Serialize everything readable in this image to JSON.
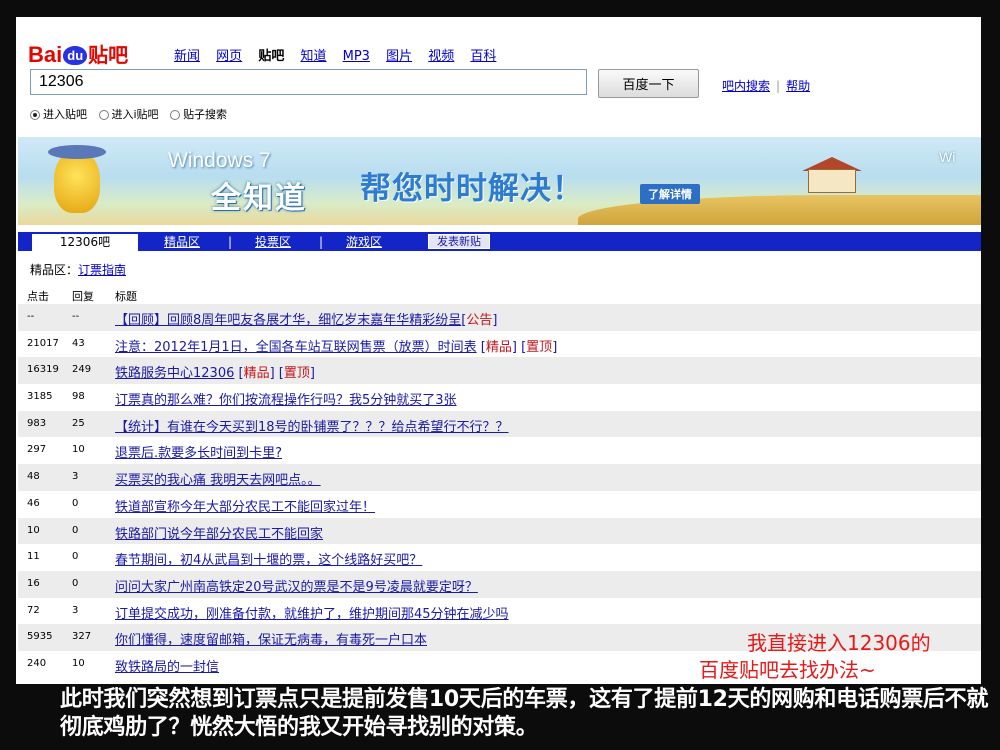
{
  "logo": {
    "part1": "Bai",
    "part2": "du",
    "part3": "贴吧"
  },
  "topnav": [
    "新闻",
    "网页",
    "贴吧",
    "知道",
    "MP3",
    "图片",
    "视频",
    "百科"
  ],
  "search": {
    "value": "12306",
    "button": "百度一下"
  },
  "right_links": [
    "吧内搜索",
    "帮助"
  ],
  "radios": [
    {
      "label": "进入贴吧",
      "checked": true
    },
    {
      "label": "进入i贴吧",
      "checked": false
    },
    {
      "label": "贴子搜索",
      "checked": false
    }
  ],
  "banner": {
    "brand": "Windows 7",
    "product": "全知道",
    "slogan": "帮您时时解决！",
    "more": "了解详情",
    "corner": "Wi"
  },
  "tabs": {
    "active": "12306吧",
    "items": [
      "精品区",
      "投票区",
      "游戏区"
    ],
    "post": "发表新贴"
  },
  "breadcrumb": {
    "section": "精品区：",
    "link": "订票指南"
  },
  "table": {
    "headers": [
      "点击",
      "回复",
      "标题"
    ],
    "rows": [
      {
        "clicks": "--",
        "replies": "--",
        "title": "【回顾】回顾8周年吧友各展才华，细忆岁末嘉年华精彩纷呈",
        "tags": [
          "公告"
        ]
      },
      {
        "clicks": "21017",
        "replies": "43",
        "title": "注意：2012年1月1日，全国各车站互联网售票（放票）时间表",
        "tags": [
          "精品",
          "置顶"
        ]
      },
      {
        "clicks": "16319",
        "replies": "249",
        "title": "铁路服务中心12306",
        "tags": [
          "精品",
          "置顶"
        ]
      },
      {
        "clicks": "3185",
        "replies": "98",
        "title": "订票真的那么难？你们按流程操作行吗？我5分钟就买了3张",
        "tags": []
      },
      {
        "clicks": "983",
        "replies": "25",
        "title": "【统计】有谁在今天买到18号的卧铺票了？？？给点希望行不行？？",
        "tags": []
      },
      {
        "clicks": "297",
        "replies": "10",
        "title": "退票后.款要多长时间到卡里?",
        "tags": []
      },
      {
        "clicks": "48",
        "replies": "3",
        "title": "买票买的我心痛 我明天去网吧点。。",
        "tags": []
      },
      {
        "clicks": "46",
        "replies": "0",
        "title": "铁道部宣称今年大部分农民工不能回家过年！",
        "tags": []
      },
      {
        "clicks": "10",
        "replies": "0",
        "title": "铁路部门说今年部分农民工不能回家",
        "tags": []
      },
      {
        "clicks": "11",
        "replies": "0",
        "title": "春节期间，初4从武昌到十堰的票，这个线路好买吧？",
        "tags": []
      },
      {
        "clicks": "16",
        "replies": "0",
        "title": "问问大家广州南高铁定20号武汉的票是不是9号凌晨就要定呀？",
        "tags": []
      },
      {
        "clicks": "72",
        "replies": "3",
        "title": "订单提交成功，刚准备付款，就维护了，维护期间那45分钟在减少吗",
        "tags": []
      },
      {
        "clicks": "5935",
        "replies": "327",
        "title": "你们懂得，速度留邮箱，保证无病毒，有毒死一户口本",
        "tags": []
      },
      {
        "clicks": "240",
        "replies": "10",
        "title": "致铁路局的一封信",
        "tags": []
      }
    ]
  },
  "annotation": {
    "line1": "我直接进入12306的",
    "line2": "百度贴吧去找办法~"
  },
  "caption": "此时我们突然想到订票点只是提前发售10天后的车票，这有了提前12天的网购和电话购票后不就彻底鸡肋了？恍然大悟的我又开始寻找别的对策。",
  "colors": {
    "tab_bar": "#1325c7",
    "link": "#1a1aa6",
    "tag": "#c4151c",
    "annotation": "#e81818",
    "frame_bg": "#0c0c0c"
  }
}
